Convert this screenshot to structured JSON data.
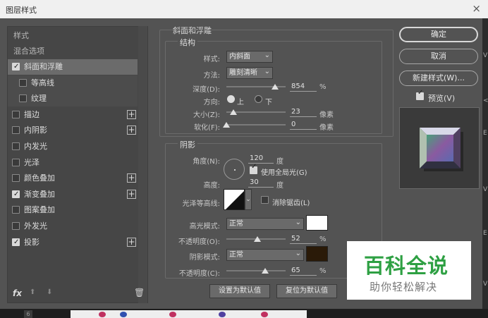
{
  "window": {
    "title": "图层样式",
    "close": "×"
  },
  "left": {
    "header_styles": "样式",
    "header_blend": "混合选项",
    "items": [
      {
        "label": "斜面和浮雕",
        "checked": true,
        "plus": false
      },
      {
        "label": "等高线",
        "checked": false,
        "plus": false
      },
      {
        "label": "纹理",
        "checked": false,
        "plus": false
      },
      {
        "label": "描边",
        "checked": false,
        "plus": true
      },
      {
        "label": "内阴影",
        "checked": false,
        "plus": true
      },
      {
        "label": "内发光",
        "checked": false,
        "plus": false
      },
      {
        "label": "光泽",
        "checked": false,
        "plus": false
      },
      {
        "label": "颜色叠加",
        "checked": false,
        "plus": true
      },
      {
        "label": "渐变叠加",
        "checked": true,
        "plus": true
      },
      {
        "label": "图案叠加",
        "checked": false,
        "plus": false
      },
      {
        "label": "外发光",
        "checked": false,
        "plus": false
      },
      {
        "label": "投影",
        "checked": true,
        "plus": true
      }
    ],
    "fx": "fx"
  },
  "bevel": {
    "title": "斜面和浮雕",
    "structure": "结构",
    "style_label": "样式:",
    "style_value": "内斜面",
    "method_label": "方法:",
    "method_value": "雕刻清晰",
    "depth_label": "深度(D):",
    "depth_value": "854",
    "depth_unit": "%",
    "depth_level": 0.82,
    "direction_label": "方向:",
    "dir_up": "上",
    "dir_down": "下",
    "size_label": "大小(Z):",
    "size_value": "23",
    "size_unit": "像素",
    "size_level": 0.12,
    "soften_label": "软化(F):",
    "soften_value": "0",
    "soften_unit": "像素",
    "soften_level": 0.0
  },
  "shading": {
    "title": "阴影",
    "angle_label": "角度(N):",
    "angle_value": "120",
    "angle_unit": "度",
    "global_light_label": "使用全局光(G)",
    "altitude_label": "高度:",
    "altitude_value": "30",
    "altitude_unit": "度",
    "gloss_label": "光泽等高线:",
    "antialias_label": "消除锯齿(L)",
    "highlight_mode_label": "高光模式:",
    "highlight_mode_value": "正常",
    "highlight_color": "#ffffff",
    "opacity1_label": "不透明度(O):",
    "opacity1_value": "52",
    "opacity1_unit": "%",
    "opacity1_level": 0.52,
    "shadow_mode_label": "阴影模式:",
    "shadow_mode_value": "正常",
    "shadow_color": "#2a1a08",
    "opacity2_label": "不透明度(C):",
    "opacity2_value": "65",
    "opacity2_unit": "%",
    "opacity2_level": 0.65
  },
  "buttons": {
    "set_default": "设置为默认值",
    "reset_default": "复位为默认值",
    "ok": "确定",
    "cancel": "取消",
    "new_style": "新建样式(W)...",
    "preview": "预览(V)"
  },
  "watermark": {
    "title": "百科全说",
    "subtitle": "助你轻松解决"
  },
  "strip": {
    "number": "6"
  },
  "rightedge": [
    "V",
    "<",
    "E",
    "V",
    "E",
    "V"
  ]
}
